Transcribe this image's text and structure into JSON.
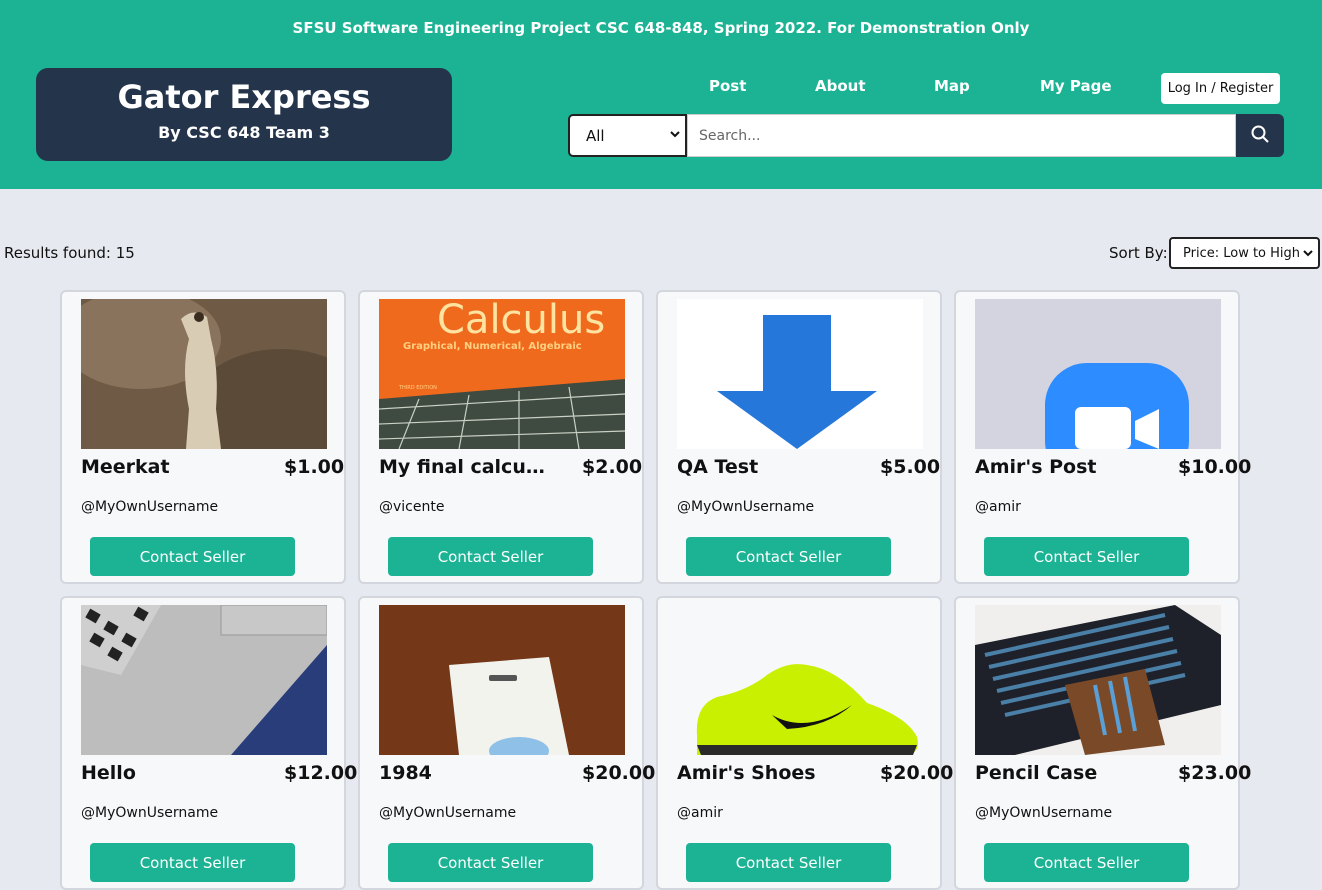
{
  "banner": "SFSU Software Engineering Project CSC 648-848, Spring 2022. For Demonstration Only",
  "brand": {
    "title": "Gator Express",
    "subtitle": "By CSC 648 Team 3"
  },
  "nav": {
    "post": "Post",
    "about": "About",
    "map": "Map",
    "my_page": "My Page",
    "login": "Log In / Register"
  },
  "search": {
    "category": "All",
    "placeholder": "Search..."
  },
  "results": {
    "label": "Results found: 15"
  },
  "sort": {
    "label": "Sort By:",
    "value": "Price: Low to High"
  },
  "contact_label": "Contact Seller",
  "listings": [
    {
      "title": "Meerkat",
      "price": "$1.00",
      "seller": "@MyOwnUsername"
    },
    {
      "title": "My final calcul...",
      "price": "$2.00",
      "seller": "@vicente"
    },
    {
      "title": "QA Test",
      "price": "$5.00",
      "seller": "@MyOwnUsername"
    },
    {
      "title": "Amir's Post",
      "price": "$10.00",
      "seller": "@amir"
    },
    {
      "title": "Hello",
      "price": "$12.00",
      "seller": "@MyOwnUsername"
    },
    {
      "title": "1984",
      "price": "$20.00",
      "seller": "@MyOwnUsername"
    },
    {
      "title": "Amir's Shoes",
      "price": "$20.00",
      "seller": "@amir"
    },
    {
      "title": "Pencil Case",
      "price": "$23.00",
      "seller": "@MyOwnUsername"
    }
  ],
  "images": {
    "calculus_text": "Calculus",
    "calculus_sub": "Graphical, Numerical, Algebraic",
    "calculus_edition": "THIRD EDITION"
  },
  "colors": {
    "header": "#1bb394",
    "brand": "#24344a",
    "button": "#1bb394"
  }
}
